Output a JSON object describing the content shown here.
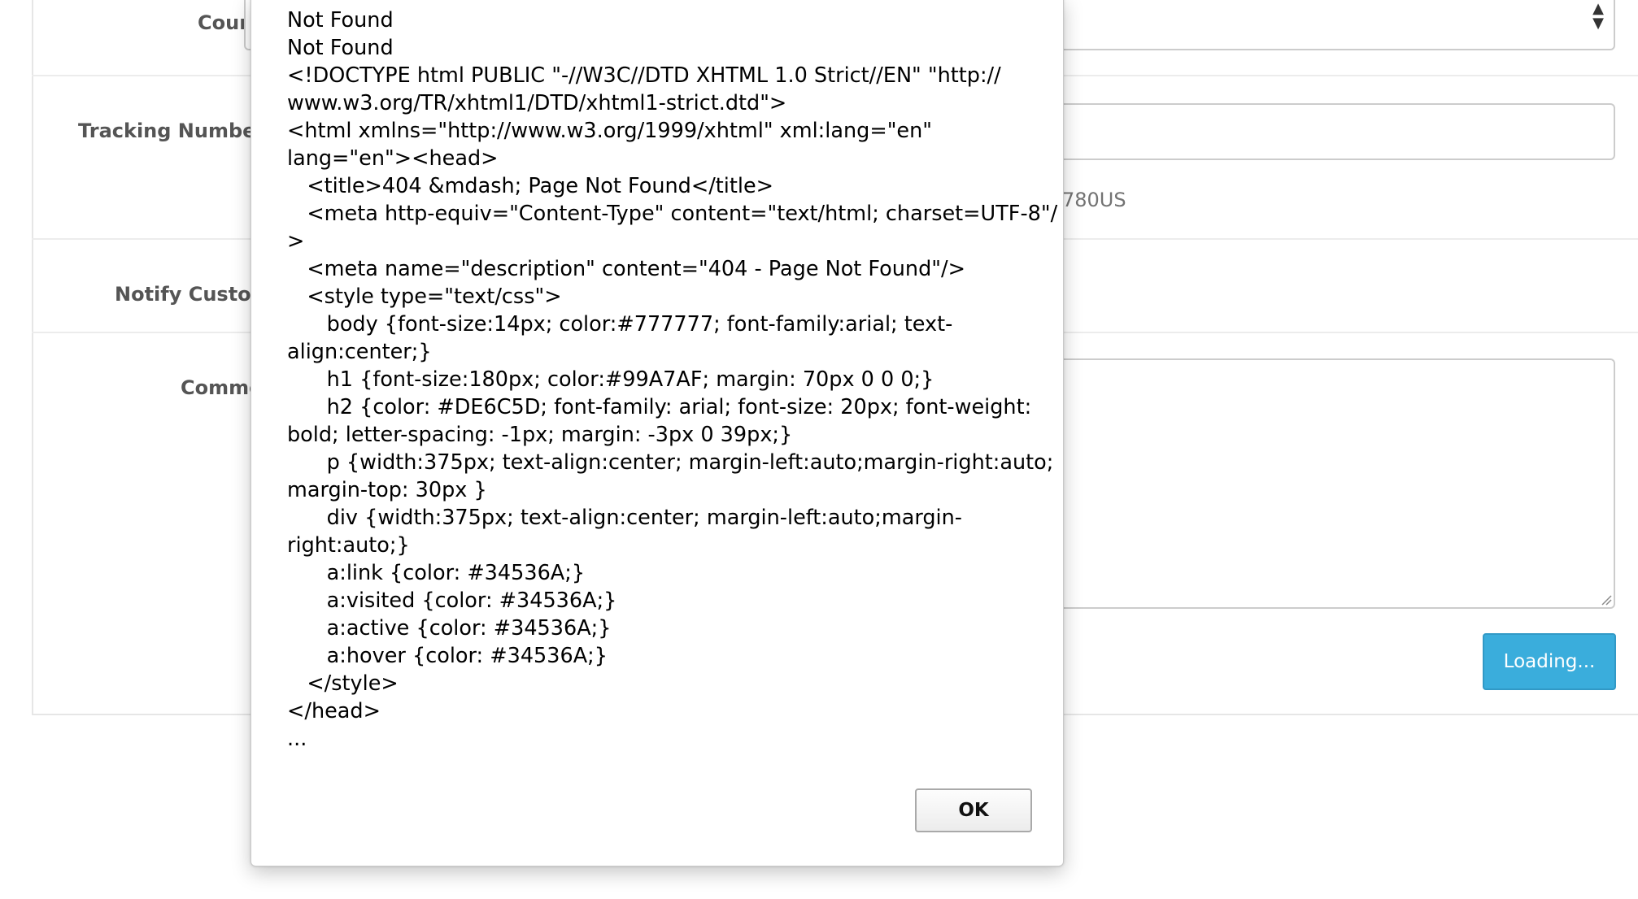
{
  "form": {
    "courier_label": "Couri",
    "tracking_label": "Tracking Number(",
    "tracking_help": "780US",
    "notify_label": "Notify Custom",
    "comment_label": "Comme",
    "submit_label": "Loading..."
  },
  "alert": {
    "message_lines": [
      "Not Found",
      "Not Found",
      "<!DOCTYPE html PUBLIC \"-//W3C//DTD XHTML 1.0 Strict//EN\" \"http://",
      "www.w3.org/TR/xhtml1/DTD/xhtml1-strict.dtd\">",
      "<html xmlns=\"http://www.w3.org/1999/xhtml\" xml:lang=\"en\"",
      "lang=\"en\"><head>",
      "   <title>404 &mdash; Page Not Found</title>",
      "   <meta http-equiv=\"Content-Type\" content=\"text/html; charset=UTF-8\"/",
      ">",
      "   <meta name=\"description\" content=\"404 - Page Not Found\"/>",
      "   <style type=\"text/css\">",
      "      body {font-size:14px; color:#777777; font-family:arial; text-",
      "align:center;}",
      "      h1 {font-size:180px; color:#99A7AF; margin: 70px 0 0 0;}",
      "      h2 {color: #DE6C5D; font-family: arial; font-size: 20px; font-weight:",
      "bold; letter-spacing: -1px; margin: -3px 0 39px;}",
      "      p {width:375px; text-align:center; margin-left:auto;margin-right:auto;",
      "margin-top: 30px }",
      "      div {width:375px; text-align:center; margin-left:auto;margin-",
      "right:auto;}",
      "      a:link {color: #34536A;}",
      "      a:visited {color: #34536A;}",
      "      a:active {color: #34536A;}",
      "      a:hover {color: #34536A;}",
      "   </style>",
      "</head>",
      "..."
    ],
    "ok_label": "OK"
  },
  "colors": {
    "button_primary": "#3aaddc",
    "label_text": "#555555",
    "input_border": "#cccccc"
  }
}
